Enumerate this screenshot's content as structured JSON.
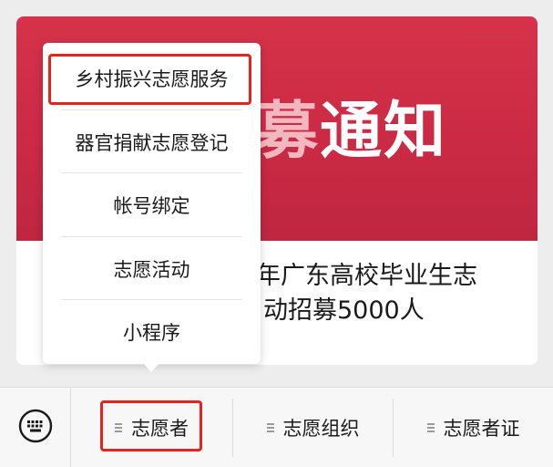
{
  "article": {
    "banner_text": "通知",
    "banner_prefix": "募",
    "headline_line1": "年广东高校毕业生志",
    "headline_line2": "动招募5000人"
  },
  "popup_menu": {
    "items": [
      {
        "label": "乡村振兴志愿服务",
        "highlighted": true
      },
      {
        "label": "器官捐献志愿登记",
        "highlighted": false
      },
      {
        "label": "帐号绑定",
        "highlighted": false
      },
      {
        "label": "志愿活动",
        "highlighted": false
      },
      {
        "label": "小程序",
        "highlighted": false
      }
    ]
  },
  "menubar": {
    "keyboard_icon": "keyboard-icon",
    "items": [
      {
        "label": "志愿者",
        "highlighted": true
      },
      {
        "label": "志愿组织",
        "highlighted": false
      },
      {
        "label": "志愿者证",
        "highlighted": false
      }
    ]
  },
  "colors": {
    "banner": "#cb2a44",
    "highlight_box": "#e8221f",
    "bar_bg": "#f7f7f7",
    "page_bg": "#ededed"
  }
}
